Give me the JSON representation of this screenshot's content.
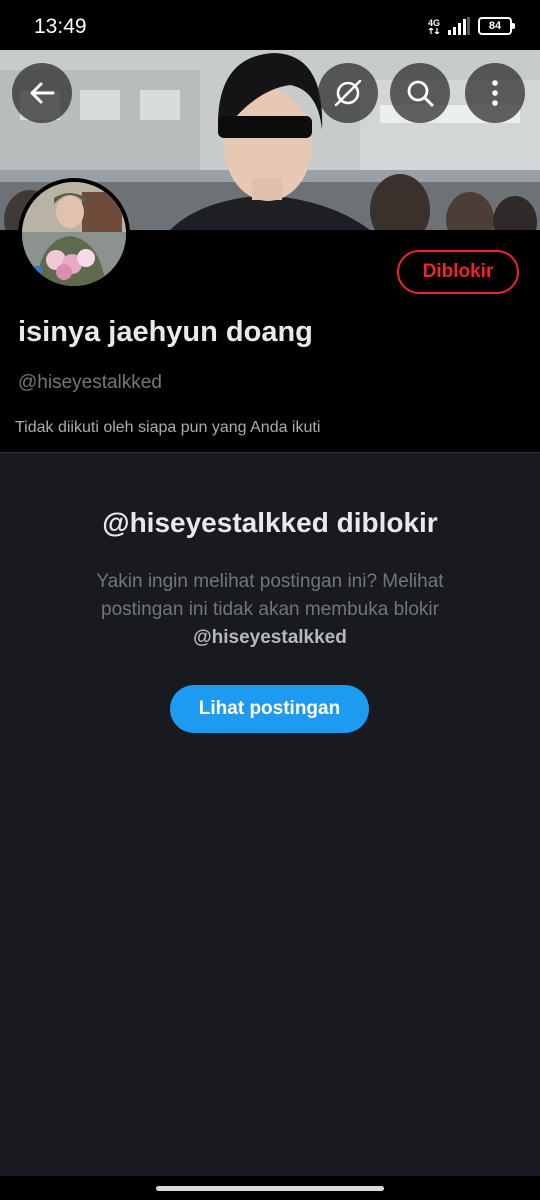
{
  "status_bar": {
    "time": "13:49",
    "network": "4G",
    "battery": "84"
  },
  "profile": {
    "display_name": "isinya jaehyun doang",
    "handle": "@hiseyestalkked",
    "followers_note": "Tidak diikuti oleh siapa pun yang Anda ikuti",
    "blocked_button_label": "Diblokir"
  },
  "blocked_notice": {
    "title": "@hiseyestalkked diblokir",
    "description_text": "Yakin ingin melihat postingan ini? Melihat postingan ini tidak akan membuka blokir",
    "description_handle": "@hiseyestalkked",
    "view_button_label": "Lihat postingan"
  },
  "colors": {
    "background": "#000000",
    "panel": "#181a1f",
    "accent_blue": "#1d9bf0",
    "blocked_red": "#f4212e",
    "secondary_text": "#71767b"
  },
  "icons": {
    "back": "arrow-left-icon",
    "grok": "grok-icon",
    "search": "search-icon",
    "more": "more-vertical-icon"
  }
}
